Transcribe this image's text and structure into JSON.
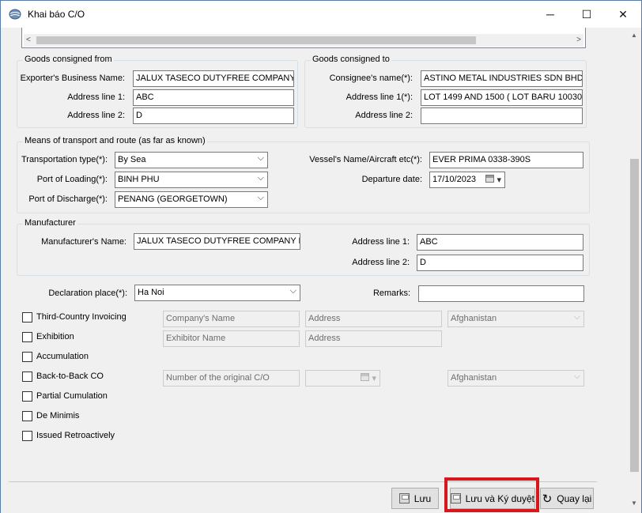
{
  "window": {
    "title": "Khai báo C/O",
    "minimize": "─",
    "maximize": "☐",
    "close": "✕"
  },
  "goods_from": {
    "title": "Goods consigned from",
    "exporter_label": "Exporter's Business Name:",
    "exporter_value": "JALUX TASECO DUTYFREE COMPANY",
    "addr1_label": "Address line 1:",
    "addr1_value": "ABC",
    "addr2_label": "Address line 2:",
    "addr2_value": "D"
  },
  "goods_to": {
    "title": "Goods consigned to",
    "consignee_label": "Consignee's name(*):",
    "consignee_value": "ASTINO METAL INDUSTRIES SDN BHD",
    "addr1_label": "Address line 1(*):",
    "addr1_value": "LOT 1499 AND 1500 ( LOT BARU 10030",
    "addr2_label": "Address line 2:",
    "addr2_value": ""
  },
  "transport": {
    "title": "Means of transport and route (as far as known)",
    "type_label": "Transportation type(*):",
    "type_value": "By Sea",
    "loading_label": "Port of Loading(*):",
    "loading_value": "BINH PHU",
    "discharge_label": "Port of Discharge(*):",
    "discharge_value": "PENANG (GEORGETOWN)",
    "vessel_label": "Vessel's Name/Aircraft etc(*):",
    "vessel_value": "EVER PRIMA 0338-390S",
    "departure_label": "Departure date:",
    "departure_value": "17/10/2023"
  },
  "manufacturer": {
    "title": "Manufacturer",
    "name_label": "Manufacturer's Name:",
    "name_value": "JALUX TASECO DUTYFREE COMPANY L",
    "addr1_label": "Address line 1:",
    "addr1_value": "ABC",
    "addr2_label": "Address line 2:",
    "addr2_value": "D"
  },
  "declaration": {
    "place_label": "Declaration place(*):",
    "place_value": "Ha Noi",
    "remarks_label": "Remarks:",
    "remarks_value": ""
  },
  "options": {
    "third_country": "Third-Country Invoicing",
    "exhibition": "Exhibition",
    "accumulation": "Accumulation",
    "back_to_back": "Back-to-Back CO",
    "partial_cumulation": "Partial Cumulation",
    "de_minimis": "De Minimis",
    "retroactive": "Issued Retroactively",
    "company_name_placeholder": "Company's Name",
    "address_placeholder": "Address",
    "country_value": "Afghanistan",
    "exhibitor_placeholder": "Exhibitor Name",
    "exhibitor_address_placeholder": "Address",
    "original_co_placeholder": "Number of the original C/O",
    "country2_value": "Afghanistan"
  },
  "buttons": {
    "save": "Lưu",
    "save_sign": "Lưu và Ký duyệt",
    "back": "Quay lại"
  },
  "colors": {
    "highlight": "#d9161c",
    "titlebar": "#ffffff",
    "background": "#f0f0f0"
  }
}
